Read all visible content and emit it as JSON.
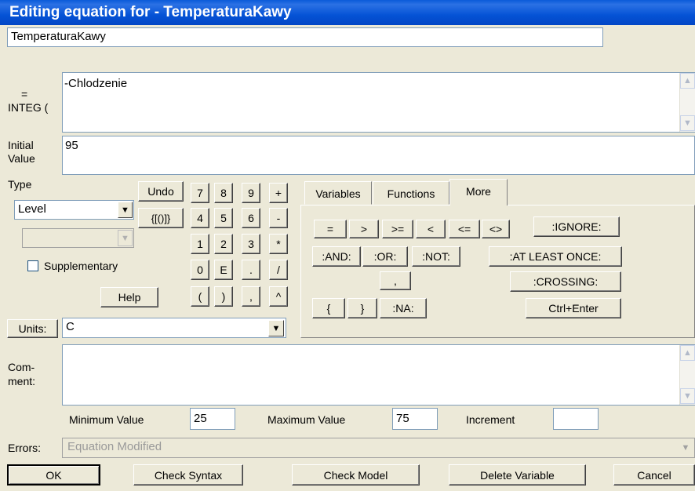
{
  "window": {
    "title": "Editing equation for - TemperaturaKawy"
  },
  "variable_name": "TemperaturaKawy",
  "equation": {
    "label_eq": "=",
    "label_integ": "INTEG (",
    "value": "-Chlodzenie"
  },
  "initial_value": {
    "label_line1": "Initial",
    "label_line2": "Value",
    "value": "95"
  },
  "type": {
    "label": "Type",
    "selected": "Level",
    "sub_selected": "",
    "supplementary_label": "Supplementary",
    "supplementary_checked": false
  },
  "keypad": {
    "undo": "Undo",
    "brackets": "{[()]}",
    "keys": [
      "7",
      "8",
      "9",
      "+",
      "4",
      "5",
      "6",
      "-",
      "1",
      "2",
      "3",
      "*",
      "0",
      "E",
      ".",
      "/",
      "(",
      ")",
      ",",
      "^"
    ],
    "help": "Help"
  },
  "units": {
    "label": "Units:",
    "value": "C"
  },
  "tabs": [
    "Variables",
    "Functions",
    "More"
  ],
  "more_buttons": {
    "eq": "=",
    "gt": ">",
    "ge": ">=",
    "lt": "<",
    "le": "<=",
    "ne": "<>",
    "ignore": ":IGNORE:",
    "and": ":AND:",
    "or": ":OR:",
    "not": ":NOT:",
    "at_least_once": ":AT LEAST ONCE:",
    "comma": ",",
    "crossing": ":CROSSING:",
    "lbrace": "{",
    "rbrace": "}",
    "na": ":NA:",
    "ctrl_enter": "Ctrl+Enter"
  },
  "comment": {
    "label_line1": "Com-",
    "label_line2": "ment:",
    "value": ""
  },
  "range": {
    "min_label": "Minimum Value",
    "min_value": "25",
    "max_label": "Maximum Value",
    "max_value": "75",
    "inc_label": "Increment",
    "inc_value": ""
  },
  "errors": {
    "label": "Errors:",
    "value": "Equation Modified"
  },
  "footer": {
    "ok": "OK",
    "check_syntax": "Check Syntax",
    "check_model": "Check Model",
    "delete_variable": "Delete Variable",
    "cancel": "Cancel"
  },
  "colors": {
    "titlebar": "#0a5ad9",
    "face": "#ece9d8",
    "field_border": "#7f9db9"
  }
}
